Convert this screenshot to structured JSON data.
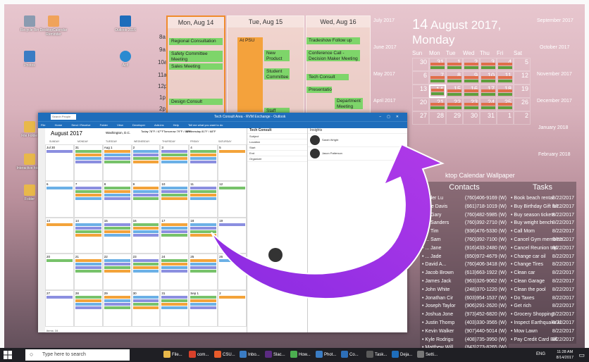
{
  "desktop": {
    "icons": [
      {
        "label": "Recycle Bin",
        "color": "#8a9bb0"
      },
      {
        "label": "DesktopCalendar Reminder",
        "color": "#f0a35a"
      },
      {
        "label": "Outlook 2016",
        "color": "#1e6dbb"
      },
      {
        "label": "Act!",
        "color": "#2a8ad0"
      },
      {
        "label": "Photos",
        "color": "#3a7cc4"
      },
      {
        "label": "File Folder",
        "color": "#e8b84a"
      },
      {
        "label": "Interactive folder",
        "color": "#e8b84a"
      },
      {
        "label": "Folder",
        "color": "#e8b84a"
      }
    ]
  },
  "day_columns": [
    {
      "header": "Mon, Aug 14",
      "events": [
        {
          "text": "Regional Consultation",
          "color": "green"
        },
        {
          "text": "Safety Committee Meeting",
          "color": "green"
        },
        {
          "text": "Sales Meeting",
          "color": "green"
        },
        {
          "text": "Design Consult",
          "color": "green"
        }
      ]
    },
    {
      "header": "Tue, Aug 15",
      "events": [
        {
          "text": "At PSU",
          "color": "orange"
        },
        {
          "text": "New Product",
          "color": "green"
        },
        {
          "text": "Student Committee",
          "color": "green"
        },
        {
          "text": "Staff",
          "color": "green"
        }
      ]
    },
    {
      "header": "Wed, Aug 16",
      "events": [
        {
          "text": "Tradeshow Follow up",
          "color": "green"
        },
        {
          "text": "Conference Call - Decision Maker Meeting",
          "color": "green"
        },
        {
          "text": "Tech Consult",
          "color": "green"
        },
        {
          "text": "Presentatio...",
          "color": "green"
        },
        {
          "text": "Department Meeting",
          "color": "green"
        }
      ]
    }
  ],
  "hours": [
    "8a",
    "9a",
    "10a",
    "11a",
    "12p",
    "1p",
    "2p"
  ],
  "mini_months": [
    "July 2017",
    "June 2017",
    "May 2017",
    "April 2017",
    "September 2017",
    "October 2017",
    "November 2017",
    "December 2017",
    "January 2018",
    "February 2018"
  ],
  "big_month": {
    "day": "14",
    "title": "August 2017, Monday",
    "dow": [
      "Sun",
      "Mon",
      "Tue",
      "Wed",
      "Thu",
      "Fri",
      "Sat"
    ],
    "weeks": [
      [
        "30",
        "31",
        "1",
        "2",
        "3",
        "4",
        "5"
      ],
      [
        "6",
        "7",
        "8",
        "9",
        "10",
        "11",
        "12"
      ],
      [
        "13",
        "14",
        "15",
        "16",
        "17",
        "18",
        "19"
      ],
      [
        "20",
        "21",
        "22",
        "23",
        "24",
        "25",
        "26"
      ],
      [
        "27",
        "28",
        "29",
        "30",
        "31",
        "1",
        "2"
      ]
    ]
  },
  "wallpaper_label": "ktop Calendar Wallpaper",
  "contacts": {
    "title": "Contacts",
    "rows": [
      {
        "name": "...der Lu",
        "phone": "(760)406-9169 (W)"
      },
      {
        "name": "Sue Davis",
        "phone": "(661)718-1019 (W)"
      },
      {
        "name": "... Gary",
        "phone": "(760)482-5985 (W)"
      },
      {
        "name": "... Sanders",
        "phone": "(760)392-2710 (W)"
      },
      {
        "name": "... Tim",
        "phone": "(936)476-5330 (W)"
      },
      {
        "name": "... Sam",
        "phone": "(760)392-7100 (W)"
      },
      {
        "name": "... Jane",
        "phone": "(916)433-2480 (W)"
      },
      {
        "name": "... Jade",
        "phone": "(650)972-4679 (W)"
      },
      {
        "name": "David A...",
        "phone": "(760)406-3418 (W)"
      },
      {
        "name": "Jacob Brown",
        "phone": "(613)663-1922 (W)"
      },
      {
        "name": "James Jack",
        "phone": "(963)326-9062 (W)"
      },
      {
        "name": "John White",
        "phone": "(248)370-1220 (W)"
      },
      {
        "name": "Jonathan Cir",
        "phone": "(603)954-1537 (W)"
      },
      {
        "name": "Joseph Taylor",
        "phone": "(906)291-2620 (W)"
      },
      {
        "name": "Joshua Jone",
        "phone": "(973)452-6820 (W)"
      },
      {
        "name": "Justin Thomp",
        "phone": "(403)330-3565 (W)"
      },
      {
        "name": "Kevin Walker",
        "phone": "(907)440-5014 (W)"
      },
      {
        "name": "Kyle Rodrigu",
        "phone": "(408)735-3950 (W)"
      },
      {
        "name": "Matthew Will",
        "phone": "(843)273-8265 (W)"
      }
    ]
  },
  "tasks": {
    "title": "Tasks",
    "rows": [
      {
        "name": "Book beach rental",
        "date": "8/22/2017"
      },
      {
        "name": "Buy Birthday Gift for...",
        "date": "8/22/2017"
      },
      {
        "name": "Buy season tickets",
        "date": "8/22/2017"
      },
      {
        "name": "Buy weight bench",
        "date": "8/22/2017"
      },
      {
        "name": "Call Mom",
        "date": "8/22/2017"
      },
      {
        "name": "Cancel Gym members...",
        "date": "8/22/2017"
      },
      {
        "name": "Cancel Reunion trip",
        "date": "8/22/2017"
      },
      {
        "name": "Change car oil",
        "date": "8/22/2017"
      },
      {
        "name": "Change Tires",
        "date": "8/22/2017"
      },
      {
        "name": "Clean car",
        "date": "8/22/2017"
      },
      {
        "name": "Clean Garage",
        "date": "8/22/2017"
      },
      {
        "name": "Clean the pool",
        "date": "8/22/2017"
      },
      {
        "name": "Do Taxes",
        "date": "8/22/2017"
      },
      {
        "name": "Get rich",
        "date": "8/22/2017"
      },
      {
        "name": "Grocery Shopping",
        "date": "8/22/2017"
      },
      {
        "name": "Inspect Earthquake ki...",
        "date": "8/22/2017"
      },
      {
        "name": "Mow Lawn",
        "date": "8/22/2017"
      },
      {
        "name": "Pay Credit Card Bill",
        "date": "8/22/2017"
      }
    ]
  },
  "outlook": {
    "search": "Search People",
    "title": "Tech Consult Area - RVM Exchange - Outlook",
    "ribbon": [
      "File",
      "Home",
      "Send / Receive",
      "Folder",
      "View",
      "Developer",
      "Add-ins",
      "Help",
      "Tell me what you want to do"
    ],
    "month": "August 2017",
    "location": "Washington, D.C.",
    "weather": [
      "Today 78°F / 67°F",
      "Tomorrow 79°F / 65°F",
      "Wednesday 81°F / 68°F"
    ],
    "days": [
      "SUNDAY",
      "MONDAY",
      "TUESDAY",
      "WEDNESDAY",
      "THURSDAY",
      "FRIDAY",
      "SATURDAY"
    ],
    "cells": [
      "Jul 30",
      "31",
      "Aug 1",
      "2",
      "3",
      "4",
      "5",
      "6",
      "7",
      "8",
      "9",
      "10",
      "11",
      "12",
      "13",
      "14",
      "15",
      "16",
      "17",
      "18",
      "19",
      "20",
      "21",
      "22",
      "23",
      "24",
      "25",
      "26",
      "27",
      "28",
      "29",
      "30",
      "31",
      "Sep 1",
      "2"
    ],
    "reading": [
      "Tech Consult",
      "Subject",
      "Location",
      "Start",
      "End",
      "Organizer"
    ],
    "people_header": "Insights",
    "people": [
      "Sarah Wright",
      "Jason Patterson"
    ],
    "status": "Items: 34"
  },
  "taskbar": {
    "search_placeholder": "Type here to search",
    "apps": [
      "File...",
      "com...",
      "CSU...",
      "Inbo...",
      "Slac...",
      "How...",
      "Phot...",
      "Co...",
      "Task...",
      "Deja...",
      "Setti..."
    ],
    "time": "11:28 AM",
    "date": "8/14/2017",
    "lang": "ENG"
  }
}
